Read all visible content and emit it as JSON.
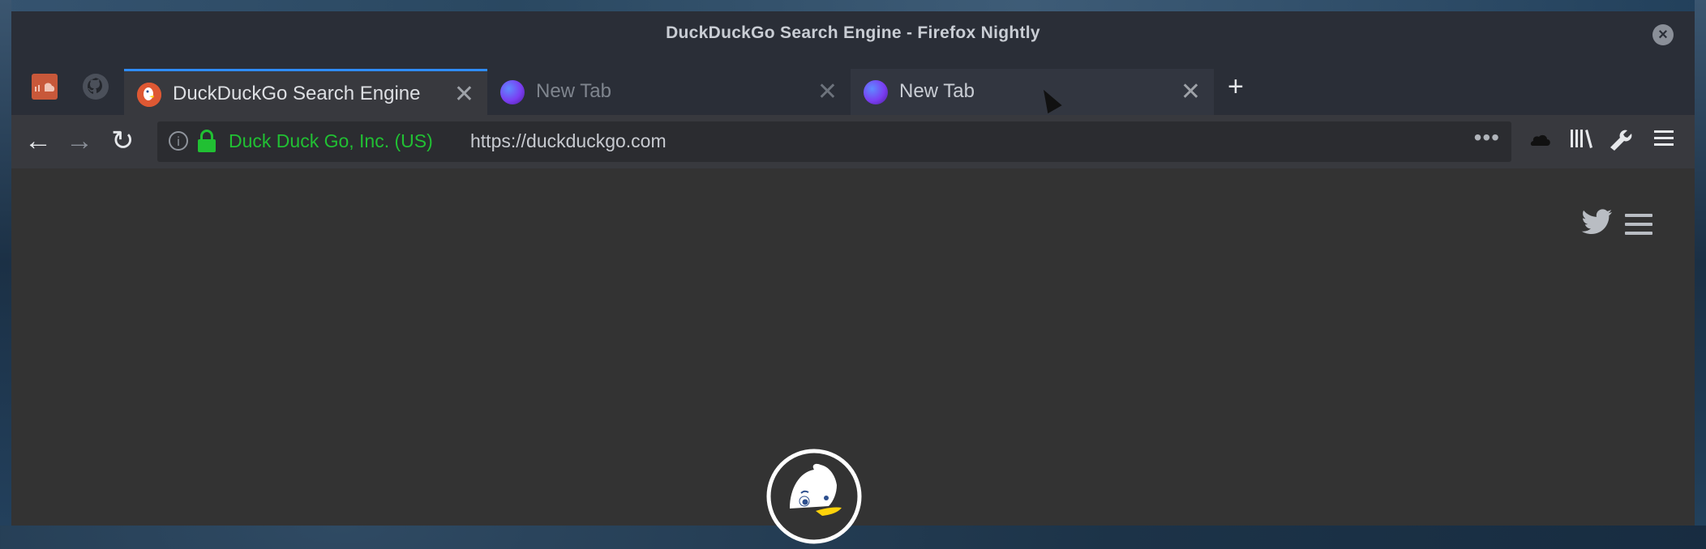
{
  "window": {
    "title": "DuckDuckGo Search Engine - Firefox Nightly"
  },
  "pinned_tabs": [
    {
      "name": "soundcloud",
      "icon": "soundcloud-icon"
    },
    {
      "name": "github",
      "icon": "github-icon"
    }
  ],
  "tabs": [
    {
      "label": "DuckDuckGo Search Engine",
      "icon": "duckduckgo-icon",
      "active": true
    },
    {
      "label": "New Tab",
      "icon": "firefox-nightly-icon",
      "active": false
    },
    {
      "label": "New Tab",
      "icon": "firefox-nightly-icon",
      "active": false,
      "hovered": true
    }
  ],
  "navbar": {
    "identity": "Duck Duck Go, Inc. (US)",
    "url": "https://duckduckgo.com",
    "page_actions": "•••"
  },
  "icons": {
    "back": "←",
    "forward": "→",
    "reload": "↻",
    "close": "✕",
    "new_tab": "+",
    "info": "i",
    "window_close": "×",
    "sync": "☁",
    "library": "|||\\",
    "hamburger": "≡"
  },
  "colors": {
    "accent": "#2f8cff",
    "secure": "#21c033",
    "ddg_orange": "#de5833"
  }
}
